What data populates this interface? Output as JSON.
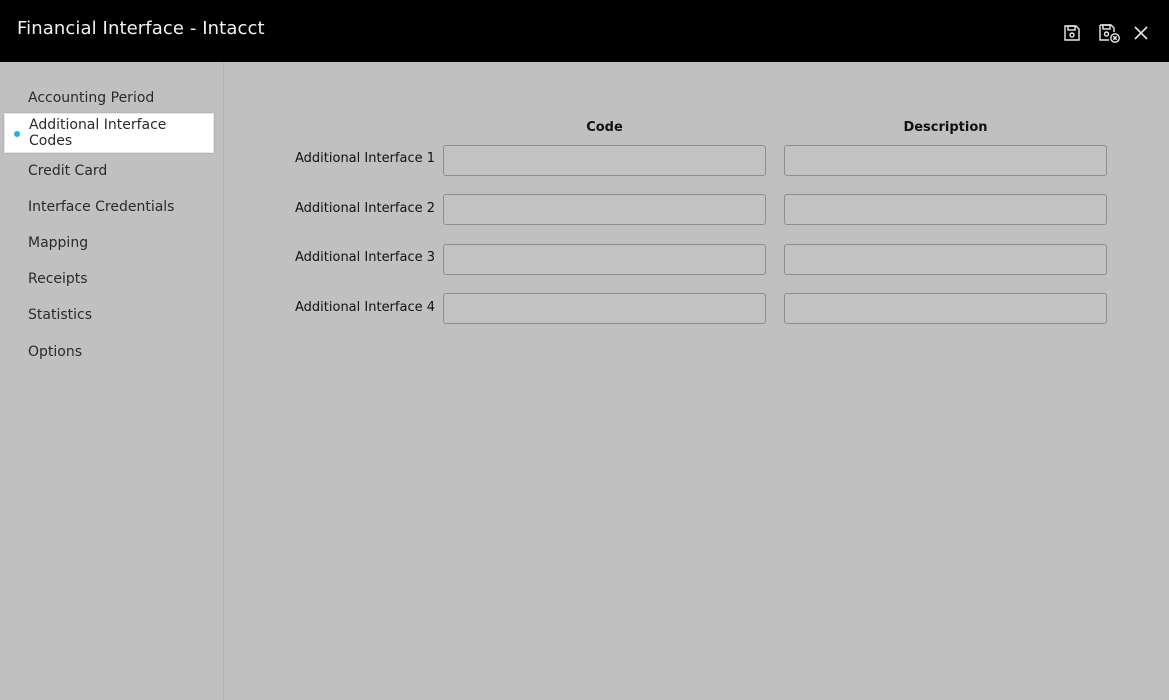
{
  "window": {
    "title": "Financial Interface - Intacct",
    "actions": {
      "save_icon": "floppy-disk-icon",
      "save_close_icon": "floppy-disk-close-icon",
      "close_icon": "close-icon"
    }
  },
  "sidebar": {
    "items": [
      {
        "label": "Accounting Period",
        "active": false
      },
      {
        "label": "Additional Interface Codes",
        "active": true
      },
      {
        "label": "Credit Card",
        "active": false
      },
      {
        "label": "Interface Credentials",
        "active": false
      },
      {
        "label": "Mapping",
        "active": false
      },
      {
        "label": "Receipts",
        "active": false
      },
      {
        "label": "Statistics",
        "active": false
      },
      {
        "label": "Options",
        "active": false
      }
    ]
  },
  "form": {
    "columns": {
      "code": "Code",
      "description": "Description"
    },
    "rows": [
      {
        "label": "Additional Interface 1",
        "code": "",
        "description": ""
      },
      {
        "label": "Additional Interface 2",
        "code": "",
        "description": ""
      },
      {
        "label": "Additional Interface 3",
        "code": "",
        "description": ""
      },
      {
        "label": "Additional Interface 4",
        "code": "",
        "description": ""
      }
    ]
  },
  "colors": {
    "titlebar": "#000000",
    "background": "#c0c0c0",
    "active_dot": "#1db4d6"
  }
}
